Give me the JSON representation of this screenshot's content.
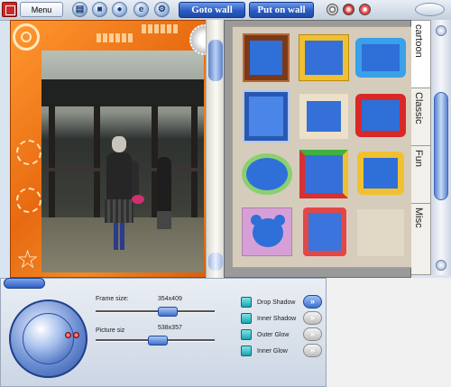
{
  "toolbar": {
    "menu_label": "Menu",
    "goto_wall_label": "Goto wall",
    "put_on_wall_label": "Put on wall",
    "icons": [
      "open-folder-icon",
      "save-icon",
      "camera-icon",
      "e-icon",
      "settings-icon"
    ]
  },
  "frame_categories": {
    "tabs": [
      "cartoon",
      "Classic",
      "Fun",
      "Misc"
    ],
    "active_tab": "cartoon"
  },
  "effects_panel": {
    "frame_size_label": "Frame size:",
    "frame_size_value": "354x409",
    "picture_size_label": "Picture siz",
    "picture_size_value": "538x357",
    "options": [
      {
        "label": "Drop Shadow",
        "checked": true
      },
      {
        "label": "Inner Shadow",
        "checked": true
      },
      {
        "label": "Outer Glow",
        "checked": true
      },
      {
        "label": "Inner Glow",
        "checked": true
      }
    ]
  },
  "colors": {
    "frame_orange": "#e86a10",
    "accent_blue": "#2a5cc4",
    "check_teal": "#1aa6b0"
  }
}
